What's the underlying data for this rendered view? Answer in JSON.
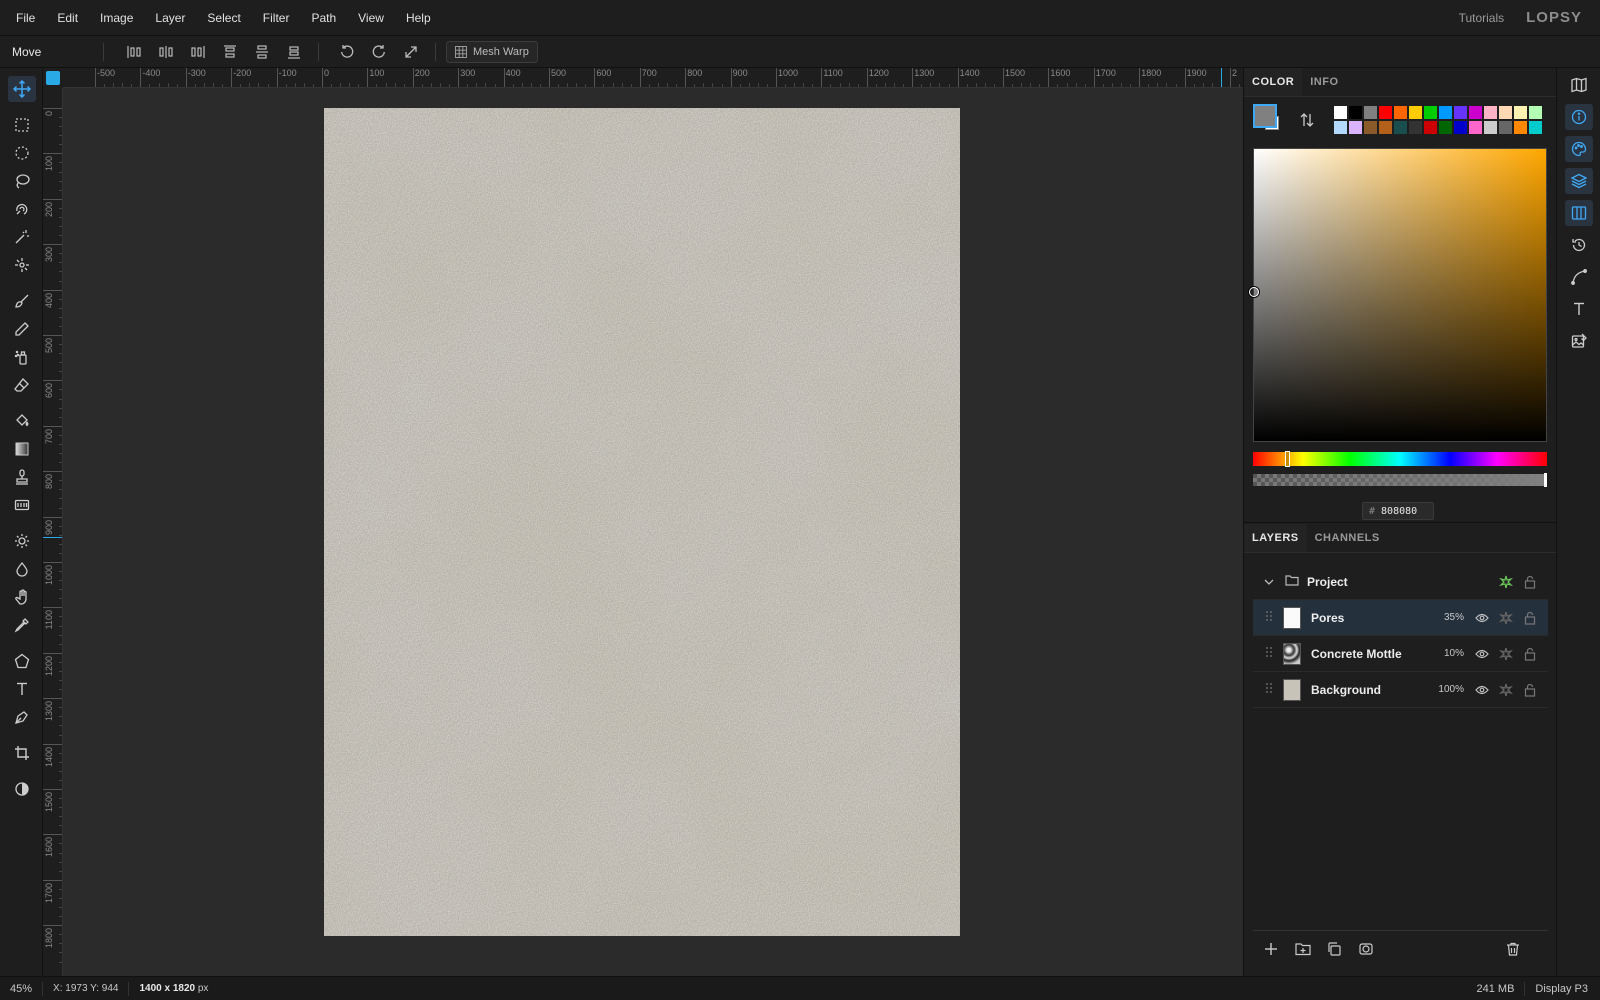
{
  "menu": {
    "items": [
      "File",
      "Edit",
      "Image",
      "Layer",
      "Select",
      "Filter",
      "Path",
      "View",
      "Help"
    ],
    "tutorials": "Tutorials",
    "logo": "LOPSY"
  },
  "options": {
    "tool_name": "Move",
    "mesh_warp": "Mesh Warp"
  },
  "rulers": {
    "h_labels": [
      "-500",
      "-400",
      "-300",
      "-200",
      "-100",
      "0",
      "100",
      "200",
      "300",
      "400",
      "500",
      "600",
      "700",
      "800",
      "900",
      "1000",
      "1100",
      "1200",
      "1300",
      "1400",
      "1500",
      "1600",
      "1700",
      "1800",
      "1900",
      "2"
    ],
    "v_labels": [
      "0",
      "100",
      "200",
      "300",
      "400",
      "500",
      "600",
      "700",
      "800",
      "900",
      "1000",
      "1100",
      "1200",
      "1300",
      "1400",
      "1500",
      "1600",
      "1700",
      "1800"
    ]
  },
  "color_panel": {
    "tabs": [
      "COLOR",
      "INFO"
    ],
    "hex_prefix": "#",
    "hex": "808080",
    "primary": "#808080",
    "swatches_row1": [
      "#ffffff",
      "#000000",
      "#808080",
      "#ff0000",
      "#ff6600",
      "#ffcc00",
      "#00cc00",
      "#0099ff",
      "#6633ff",
      "#cc00cc",
      "#ffb3c6",
      "#ffd9b3",
      "#fff3b3",
      "#b3ffb3"
    ],
    "swatches_row2": [
      "#b3d9ff",
      "#d9b3ff",
      "#8a5a2b",
      "#b3611a",
      "#1a4d4d",
      "#333333",
      "#cc0000",
      "#006600",
      "#0000cc",
      "#ff66cc",
      "#cccccc",
      "#666666",
      "#ff8800",
      "#00cccc"
    ]
  },
  "layers_panel": {
    "tabs": [
      "LAYERS",
      "CHANNELS"
    ],
    "group": "Project",
    "layers": [
      {
        "name": "Pores",
        "opacity": "35%"
      },
      {
        "name": "Concrete Mottle",
        "opacity": "10%"
      },
      {
        "name": "Background",
        "opacity": "100%"
      }
    ]
  },
  "status": {
    "zoom": "45%",
    "coords": "X: 1973  Y: 944",
    "size": "1400 x 1820",
    "size_unit": "px",
    "memory": "241 MB",
    "profile": "Display P3"
  }
}
